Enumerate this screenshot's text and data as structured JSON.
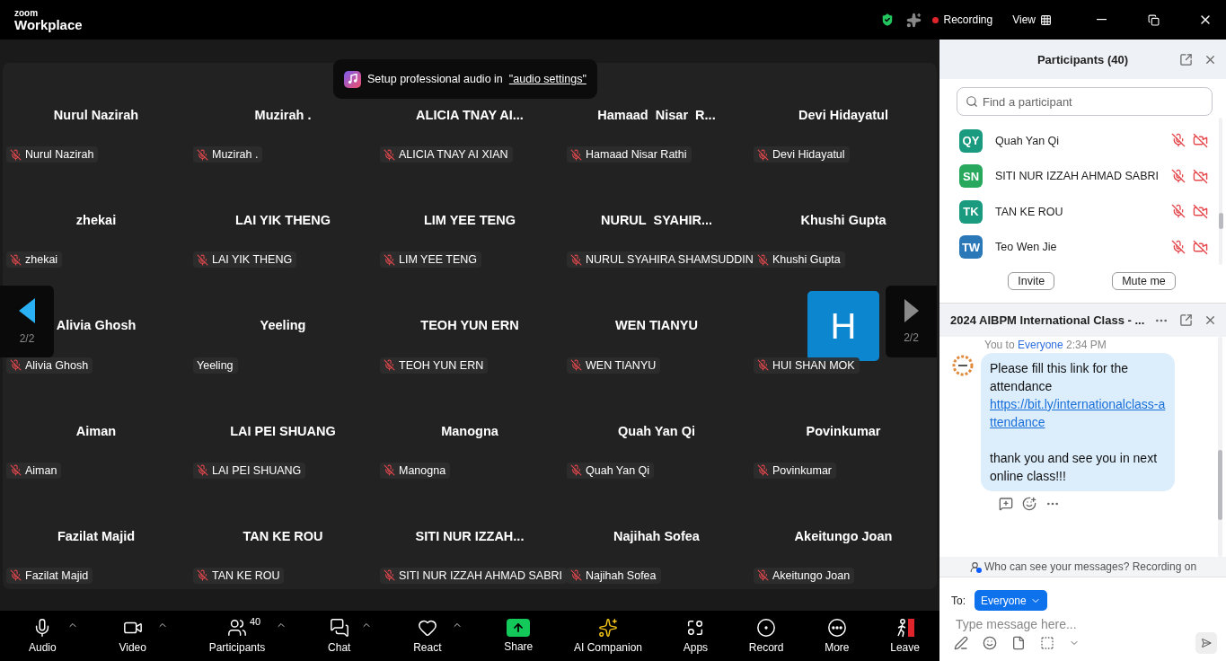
{
  "app": {
    "logo_top": "zoom",
    "logo_bottom": "Workplace"
  },
  "top_bar": {
    "recording": "Recording",
    "view": "View"
  },
  "toast": {
    "text": "Setup professional audio in",
    "link": "\"audio settings\""
  },
  "gallery": {
    "prev_page": "2/2",
    "next_page": "2/2",
    "tiles": [
      {
        "kind": "name",
        "title": "Nurul Nazirah",
        "name": "Nurul Nazirah",
        "muted": true
      },
      {
        "kind": "name",
        "title": "Muzirah .",
        "name": "Muzirah .",
        "muted": true
      },
      {
        "kind": "name",
        "title": "ALICIA TNAY AI...",
        "name": "ALICIA TNAY AI XIAN",
        "muted": true
      },
      {
        "kind": "name",
        "title": "Hamaad  Nisar  R...",
        "name": "Hamaad Nisar Rathi",
        "muted": true
      },
      {
        "kind": "name",
        "title": "Devi Hidayatul",
        "name": "Devi Hidayatul",
        "muted": true
      },
      {
        "kind": "name",
        "title": "zhekai",
        "name": "zhekai",
        "muted": true
      },
      {
        "kind": "name",
        "title": "LAI YIK THENG",
        "name": "LAI YIK THENG",
        "muted": true
      },
      {
        "kind": "name",
        "title": "LIM YEE TENG",
        "name": "LIM YEE TENG",
        "muted": true
      },
      {
        "kind": "name",
        "title": "NURUL  SYAHIR...",
        "name": "NURUL SYAHIRA SHAMSUDDIN",
        "muted": true
      },
      {
        "kind": "name",
        "title": "Khushi Gupta",
        "name": "Khushi Gupta",
        "muted": true
      },
      {
        "kind": "name",
        "title": "Alivia Ghosh",
        "name": "Alivia Ghosh",
        "muted": true
      },
      {
        "kind": "name",
        "title": "Yeeling",
        "name": "Yeeling",
        "muted": false
      },
      {
        "kind": "name",
        "title": "TEOH YUN ERN",
        "name": "TEOH YUN ERN",
        "muted": true
      },
      {
        "kind": "name",
        "title": "WEN TIANYU",
        "name": "WEN TIANYU",
        "muted": true
      },
      {
        "kind": "avatar",
        "initial": "H",
        "name": "HUI SHAN MOK",
        "muted": true
      },
      {
        "kind": "name",
        "title": "Aiman",
        "name": "Aiman",
        "muted": true
      },
      {
        "kind": "name",
        "title": "LAI PEI SHUANG",
        "name": "LAI PEI SHUANG",
        "muted": true
      },
      {
        "kind": "name",
        "title": "Manogna",
        "name": "Manogna",
        "muted": true
      },
      {
        "kind": "name",
        "title": "Quah Yan Qi",
        "name": "Quah Yan Qi",
        "muted": true
      },
      {
        "kind": "name",
        "title": "Povinkumar",
        "name": "Povinkumar",
        "muted": true
      },
      {
        "kind": "name",
        "title": "Fazilat Majid",
        "name": "Fazilat Majid",
        "muted": true
      },
      {
        "kind": "name",
        "title": "TAN KE ROU",
        "name": "TAN KE ROU",
        "muted": true
      },
      {
        "kind": "name",
        "title": "SITI NUR IZZAH...",
        "name": "SITI NUR IZZAH AHMAD SABRI",
        "muted": true
      },
      {
        "kind": "name",
        "title": "Najihah Sofea",
        "name": "Najihah Sofea",
        "muted": true
      },
      {
        "kind": "name",
        "title": "Akeitungo Joan",
        "name": "Akeitungo Joan",
        "muted": true
      }
    ]
  },
  "toolbar": [
    {
      "kind": "audio",
      "label": "Audio",
      "caret": true
    },
    {
      "kind": "video",
      "label": "Video",
      "caret": true
    },
    {
      "kind": "participants",
      "label": "Participants",
      "count": "40",
      "caret": true
    },
    {
      "kind": "chat",
      "label": "Chat",
      "caret": true
    },
    {
      "kind": "react",
      "label": "React",
      "caret": true
    },
    {
      "kind": "share",
      "label": "Share"
    },
    {
      "kind": "ai",
      "label": "AI Companion"
    },
    {
      "kind": "apps",
      "label": "Apps"
    },
    {
      "kind": "record",
      "label": "Record"
    },
    {
      "kind": "more",
      "label": "More"
    },
    {
      "kind": "leave",
      "label": "Leave"
    }
  ],
  "participants_panel": {
    "title": "Participants (40)",
    "search_placeholder": "Find a participant",
    "people": [
      {
        "initials": "QY",
        "name": "Quah Yan Qi",
        "color": "#1a9b80",
        "muted": true,
        "video_off": true
      },
      {
        "initials": "SN",
        "name": "SITI NUR IZZAH AHMAD SABRI",
        "color": "#27a85c",
        "muted": true,
        "video_off": true
      },
      {
        "initials": "TK",
        "name": "TAN KE ROU",
        "color": "#1a9b80",
        "muted": true,
        "video_off": true
      },
      {
        "initials": "TW",
        "name": "Teo Wen Jie",
        "color": "#2b78b8",
        "muted": true,
        "video_off": true
      }
    ],
    "buttons": [
      "Invite",
      "Mute me"
    ]
  },
  "chat": {
    "title": "2024 AIBPM International Class - ...",
    "sender": "You",
    "to_word": "to",
    "recipient": "Everyone",
    "time": "2:34 PM",
    "message": [
      {
        "kind": "text",
        "text": "Please fill this link for the attendance"
      },
      {
        "kind": "link",
        "text": "https://bit.ly/internationalclass-attendance"
      },
      {
        "kind": "gap"
      },
      {
        "kind": "text",
        "text": "thank you and see you in next online class!!!"
      }
    ],
    "notice": "Who can see your messages? Recording on",
    "to_label": "To:",
    "to_value": "Everyone",
    "input_placeholder": "Type message here..."
  }
}
